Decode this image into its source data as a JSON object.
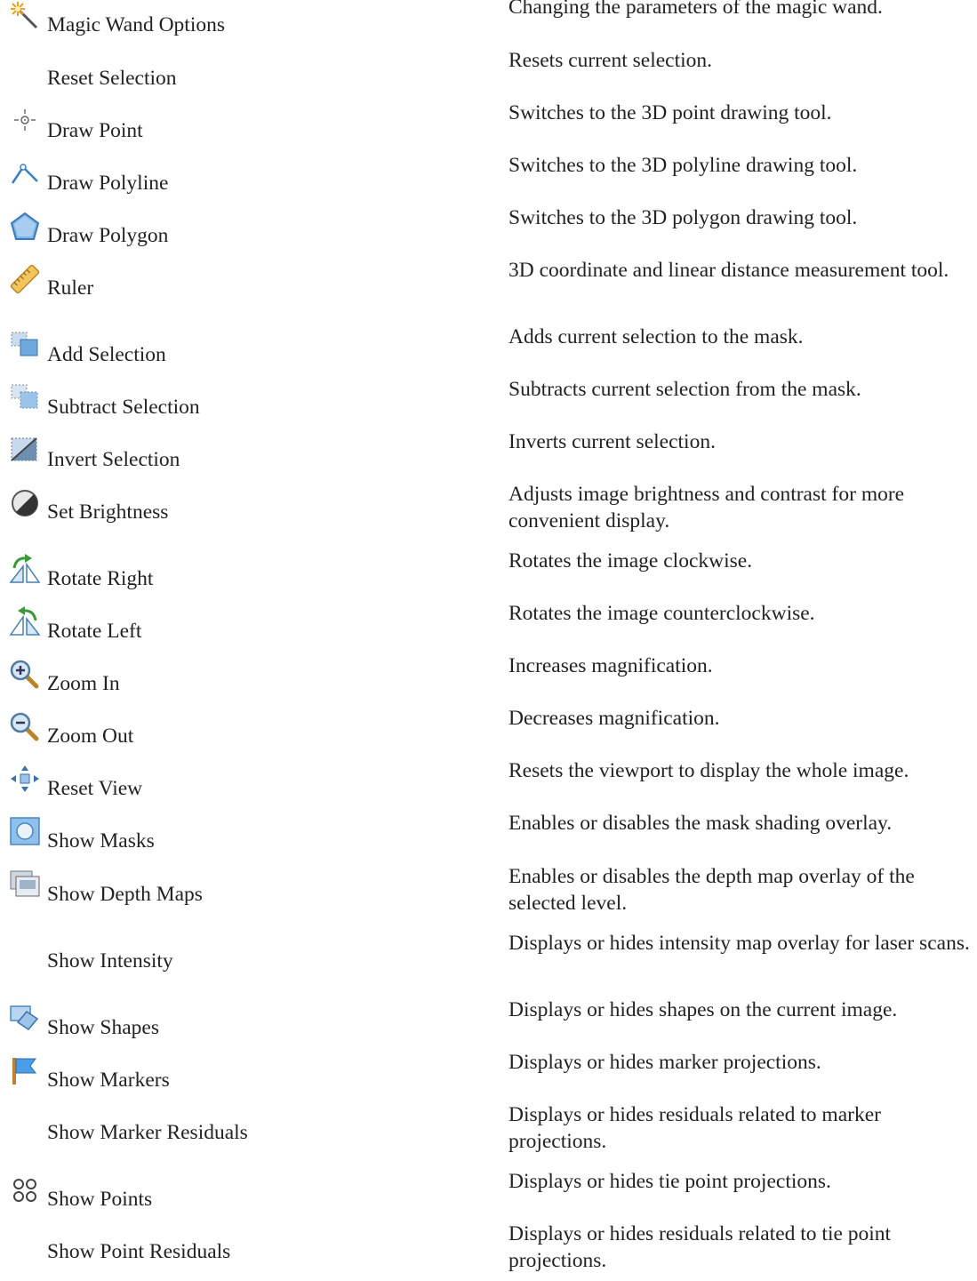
{
  "rows": [
    {
      "icon": "magic-wand-icon",
      "label": "Magic Wand Options",
      "desc": "Changing the parameters of the magic wand."
    },
    {
      "icon": "",
      "label": "Reset Selection",
      "desc": "Resets current selection."
    },
    {
      "icon": "draw-point-icon",
      "label": "Draw Point",
      "desc": "Switches to the 3D point drawing tool."
    },
    {
      "icon": "draw-polyline-icon",
      "label": "Draw Polyline",
      "desc": "Switches to the 3D polyline drawing tool."
    },
    {
      "icon": "draw-polygon-icon",
      "label": "Draw Polygon",
      "desc": "Switches to the 3D polygon drawing tool."
    },
    {
      "icon": "ruler-icon",
      "label": "Ruler",
      "desc": "3D coordinate and linear distance measurement tool."
    },
    {
      "icon": "add-selection-icon",
      "label": "Add Selection",
      "desc": "Adds current selection to the mask."
    },
    {
      "icon": "subtract-selection-icon",
      "label": "Subtract Selection",
      "desc": "Subtracts current selection from the mask."
    },
    {
      "icon": "invert-selection-icon",
      "label": "Invert Selection",
      "desc": "Inverts current selection."
    },
    {
      "icon": "brightness-icon",
      "label": "Set Brightness",
      "desc": "Adjusts image brightness and contrast for more convenient display."
    },
    {
      "icon": "rotate-right-icon",
      "label": "Rotate Right",
      "desc": "Rotates the image clockwise."
    },
    {
      "icon": "rotate-left-icon",
      "label": "Rotate Left",
      "desc": "Rotates the image counterclockwise."
    },
    {
      "icon": "zoom-in-icon",
      "label": "Zoom In",
      "desc": "Increases magnification."
    },
    {
      "icon": "zoom-out-icon",
      "label": "Zoom Out",
      "desc": "Decreases magnification."
    },
    {
      "icon": "reset-view-icon",
      "label": "Reset View",
      "desc": "Resets the viewport to display the whole image."
    },
    {
      "icon": "show-masks-icon",
      "label": "Show Masks",
      "desc": "Enables or disables the mask shading overlay."
    },
    {
      "icon": "show-depth-maps-icon",
      "label": "Show Depth Maps",
      "desc": "Enables or disables the depth map overlay of the selected level."
    },
    {
      "icon": "",
      "label": "Show Intensity",
      "desc": "Displays or hides intensity map overlay for laser scans."
    },
    {
      "icon": "show-shapes-icon",
      "label": "Show Shapes",
      "desc": "Displays or hides shapes on the current image."
    },
    {
      "icon": "show-markers-icon",
      "label": "Show Markers",
      "desc": "Displays or hides marker projections."
    },
    {
      "icon": "",
      "label": "Show Marker Residuals",
      "desc": "Displays or hides residuals related to marker projections."
    },
    {
      "icon": "show-points-icon",
      "label": "Show Points",
      "desc": "Displays or hides tie point projections."
    },
    {
      "icon": "",
      "label": "Show Point Residuals",
      "desc": "Displays or hides residuals related to tie point projections."
    }
  ]
}
